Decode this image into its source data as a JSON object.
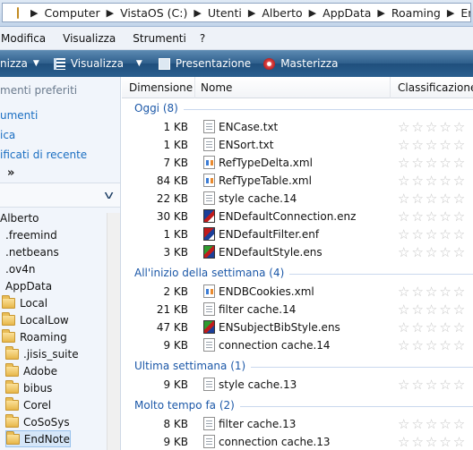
{
  "address": {
    "crumbs": [
      "Computer",
      "VistaOS (C:)",
      "Utenti",
      "Alberto",
      "AppData",
      "Roaming",
      "EndNote"
    ]
  },
  "menu": [
    "Modifica",
    "Visualizza",
    "Strumenti",
    "?"
  ],
  "toolbar": {
    "organize": "nizza",
    "views": "Visualizza",
    "presentation": "Presentazione",
    "burn": "Masterizza"
  },
  "nav": {
    "favorites_header": "menti preferiti",
    "links": [
      "umenti",
      "ica",
      "ificati di recente"
    ],
    "more": "»",
    "tree": [
      {
        "label": "Alberto",
        "folder": false
      },
      {
        "label": ".freemind",
        "folder": false
      },
      {
        "label": ".netbeans",
        "folder": false
      },
      {
        "label": ".ov4n",
        "folder": false
      },
      {
        "label": "AppData",
        "folder": false
      },
      {
        "label": "Local",
        "folder": true
      },
      {
        "label": "LocalLow",
        "folder": true
      },
      {
        "label": "Roaming",
        "folder": true
      },
      {
        "label": ".jisis_suite",
        "folder": true
      },
      {
        "label": "Adobe",
        "folder": true
      },
      {
        "label": "bibus",
        "folder": true
      },
      {
        "label": "Corel",
        "folder": true
      },
      {
        "label": "CoSoSys",
        "folder": true
      },
      {
        "label": "EndNote",
        "folder": true,
        "selected": true
      }
    ]
  },
  "columns": {
    "size": "Dimensione",
    "name": "Nome",
    "rating": "Classificazione"
  },
  "groups": [
    {
      "title": "Oggi (8)",
      "files": [
        {
          "size": "1 KB",
          "name": "ENCase.txt",
          "icon": "text-file-icon"
        },
        {
          "size": "1 KB",
          "name": "ENSort.txt",
          "icon": "text-file-icon"
        },
        {
          "size": "7 KB",
          "name": "RefTypeDelta.xml",
          "icon": "xml-file-icon"
        },
        {
          "size": "84 KB",
          "name": "RefTypeTable.xml",
          "icon": "xml-file-icon"
        },
        {
          "size": "22 KB",
          "name": "style cache.14",
          "icon": "file-icon"
        },
        {
          "size": "30 KB",
          "name": "ENDefaultConnection.enz",
          "icon": "endnote-connection-icon"
        },
        {
          "size": "1 KB",
          "name": "ENDefaultFilter.enf",
          "icon": "endnote-filter-icon"
        },
        {
          "size": "3 KB",
          "name": "ENDefaultStyle.ens",
          "icon": "endnote-style-icon"
        }
      ]
    },
    {
      "title": "All'inizio della settimana (4)",
      "files": [
        {
          "size": "2 KB",
          "name": "ENDBCookies.xml",
          "icon": "xml-file-icon"
        },
        {
          "size": "21 KB",
          "name": "filter cache.14",
          "icon": "file-icon"
        },
        {
          "size": "47 KB",
          "name": "ENSubjectBibStyle.ens",
          "icon": "endnote-style-icon"
        },
        {
          "size": "9 KB",
          "name": "connection cache.14",
          "icon": "file-icon"
        }
      ]
    },
    {
      "title": "Ultima settimana (1)",
      "files": [
        {
          "size": "9 KB",
          "name": "style cache.13",
          "icon": "file-icon"
        }
      ]
    },
    {
      "title": "Molto tempo fa (2)",
      "files": [
        {
          "size": "8 KB",
          "name": "filter cache.13",
          "icon": "file-icon"
        },
        {
          "size": "9 KB",
          "name": "connection cache.13",
          "icon": "file-icon"
        }
      ]
    }
  ],
  "rating_glyphs": "☆☆☆☆☆",
  "colors": {
    "accent": "#1c58a8",
    "toolbar": "#2e5f8c",
    "selection": "#d5e6f8"
  }
}
